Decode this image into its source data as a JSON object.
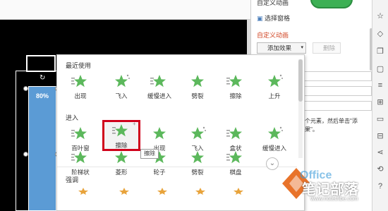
{
  "task_pane": {
    "header": "自定义动画",
    "select_pane": "选择窗格",
    "section_title": "自定义动画",
    "add_effect": "添加效果",
    "delete": "删除",
    "hint": "个元素，然后单击\"添",
    "hint2": "果\"。"
  },
  "slide": {
    "bar_label": "80%"
  },
  "effects_panel": {
    "recent": {
      "title": "最近使用",
      "items": [
        "出现",
        "飞入",
        "缓慢进入",
        "劈裂",
        "擦除",
        "上升"
      ]
    },
    "entrance": {
      "title": "进入",
      "items": [
        "百叶窗",
        "擦除",
        "出现",
        "飞入",
        "盒状",
        "缓慢进入",
        "阶梯状",
        "菱形",
        "轮子",
        "劈裂",
        "棋盘"
      ],
      "selected": "擦除"
    },
    "emphasis": {
      "title": "强调"
    },
    "tooltip": "擦除"
  },
  "watermark": {
    "brand": "Office",
    "name": "笔记部落",
    "url": "www.notetribe.com"
  },
  "colors": {
    "accent": "#d24726",
    "star_green": "#5cb85c",
    "selection_red": "#d0021b",
    "bar_blue": "#5b9bd5"
  }
}
